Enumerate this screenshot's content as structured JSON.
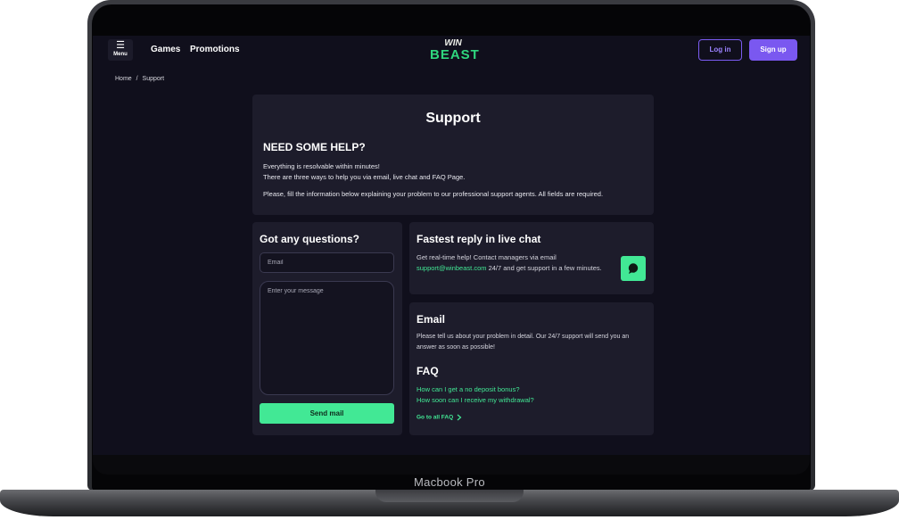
{
  "device": {
    "label": "Macbook Pro"
  },
  "header": {
    "menu_label": "Menu",
    "nav": [
      "Games",
      "Promotions"
    ],
    "logo_top": "WIN",
    "logo_bottom": "BEAST",
    "login_label": "Log in",
    "signup_label": "Sign up"
  },
  "breadcrumb": {
    "home": "Home",
    "sep": "/",
    "current": "Support"
  },
  "support": {
    "title": "Support",
    "subtitle": "NEED SOME HELP?",
    "line1": "Everything is resolvable within minutes!",
    "line2": "There are three ways to help you via email, live chat and FAQ Page.",
    "line3": "Please, fill the information below explaining your problem to our professional support agents. All fields are required."
  },
  "contact_form": {
    "title": "Got any questions?",
    "email_placeholder": "Email",
    "message_placeholder": "Enter your message",
    "send_label": "Send mail"
  },
  "live_chat": {
    "title": "Fastest reply in live chat",
    "text_before": "Get real-time help! Contact managers via email ",
    "email": "support@winbeast.com",
    "text_after": " 24/7 and get support in a few minutes."
  },
  "email_section": {
    "title": "Email",
    "text": "Please tell us about your problem in detail. Our 24/7 support will send you an answer as soon as possible!"
  },
  "faq": {
    "title": "FAQ",
    "links": [
      "How can I get a no deposit bonus?",
      "How soon can I receive my withdrawal?"
    ],
    "all_label": "Go to all FAQ"
  },
  "colors": {
    "background": "#100f1c",
    "card": "#1d1c2b",
    "accent_green": "#42e895",
    "accent_purple": "#7a58f0"
  }
}
